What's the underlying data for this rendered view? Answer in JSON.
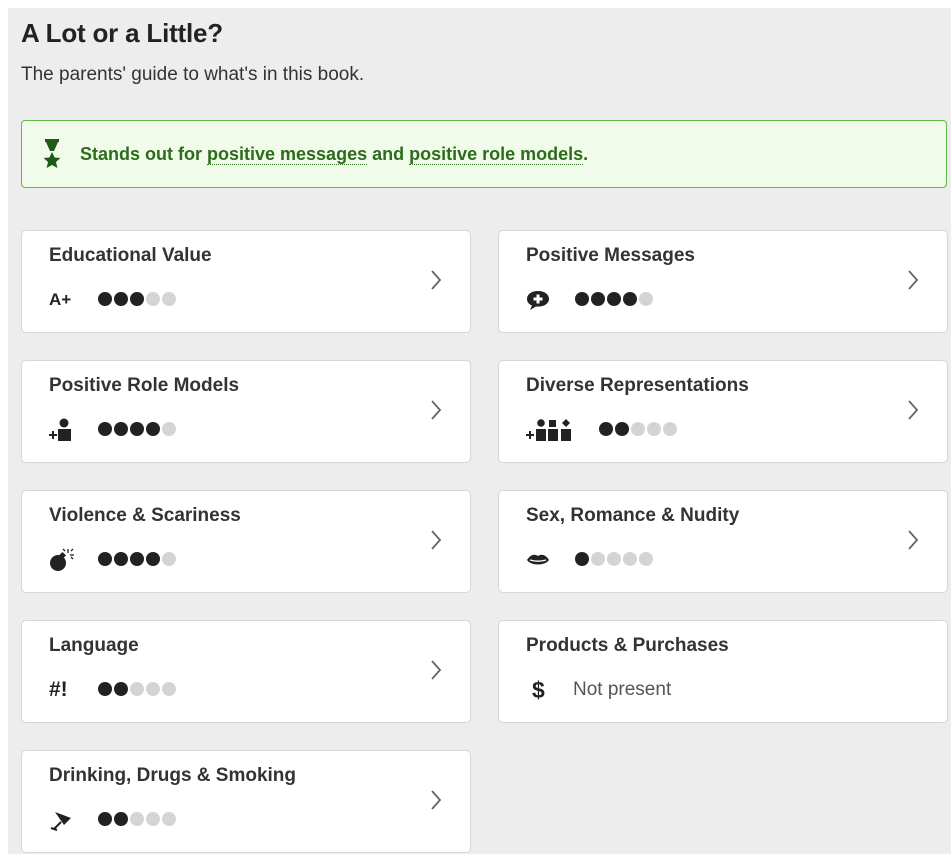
{
  "header": {
    "title": "A Lot or a Little?",
    "subtitle": "The parents' guide to what's in this book."
  },
  "standout": {
    "prefix": "Stands out for ",
    "link1": "positive messages",
    "middle": " and ",
    "link2": "positive role models",
    "suffix": ".",
    "icon": "award-icon"
  },
  "cards": [
    {
      "label": "Educational Value",
      "icon": "educational-icon",
      "icon_text": "A+",
      "rating": 3,
      "max": 5
    },
    {
      "label": "Positive Messages",
      "icon": "speech-bubble-plus-icon",
      "rating": 4,
      "max": 5
    },
    {
      "label": "Positive Role Models",
      "icon": "person-plus-icon",
      "rating": 4,
      "max": 5
    },
    {
      "label": "Diverse Representations",
      "icon": "people-group-plus-icon",
      "rating": 2,
      "max": 5
    },
    {
      "label": "Violence & Scariness",
      "icon": "bomb-icon",
      "rating": 4,
      "max": 5
    },
    {
      "label": "Sex, Romance & Nudity",
      "icon": "lips-icon",
      "rating": 1,
      "max": 5
    },
    {
      "label": "Language",
      "icon": "language-icon",
      "icon_text": "#!",
      "rating": 2,
      "max": 5
    },
    {
      "label": "Products & Purchases",
      "icon": "dollar-icon",
      "icon_text": "$",
      "status": "Not present"
    },
    {
      "label": "Drinking, Drugs & Smoking",
      "icon": "drink-icon",
      "rating": 2,
      "max": 5
    }
  ]
}
